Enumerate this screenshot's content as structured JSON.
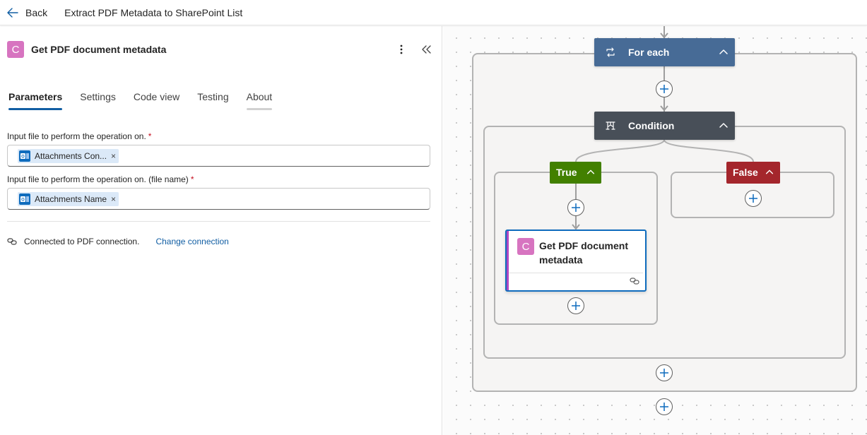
{
  "topbar": {
    "back_label": "Back",
    "flow_title": "Extract PDF Metadata to SharePoint List"
  },
  "panel": {
    "icon_letter": "C",
    "title": "Get PDF document metadata",
    "tabs": [
      {
        "label": "Parameters",
        "active": true
      },
      {
        "label": "Settings",
        "active": false
      },
      {
        "label": "Code view",
        "active": false
      },
      {
        "label": "Testing",
        "active": false
      },
      {
        "label": "About",
        "active": false
      }
    ],
    "fields": [
      {
        "label": "Input file to perform the operation on.",
        "required_mark": "*",
        "token": "Attachments Con...",
        "token_close": "×"
      },
      {
        "label": "Input file to perform the operation on. (file name)",
        "required_mark": "*",
        "token": "Attachments Name",
        "token_close": "×"
      }
    ],
    "connection_text": "Connected to PDF connection.",
    "change_connection": "Change connection"
  },
  "canvas": {
    "for_each": {
      "label": "For each",
      "color": "#476b96"
    },
    "condition": {
      "label": "Condition",
      "color": "#484f58"
    },
    "true_branch": {
      "label": "True",
      "color": "#428000"
    },
    "false_branch": {
      "label": "False",
      "color": "#a4262c"
    },
    "action": {
      "icon_letter": "C",
      "title": "Get PDF document metadata"
    }
  },
  "colors": {
    "accent": "#115ea3",
    "connector_icon": "#d774c0",
    "selected_border": "#0f6cbd"
  }
}
